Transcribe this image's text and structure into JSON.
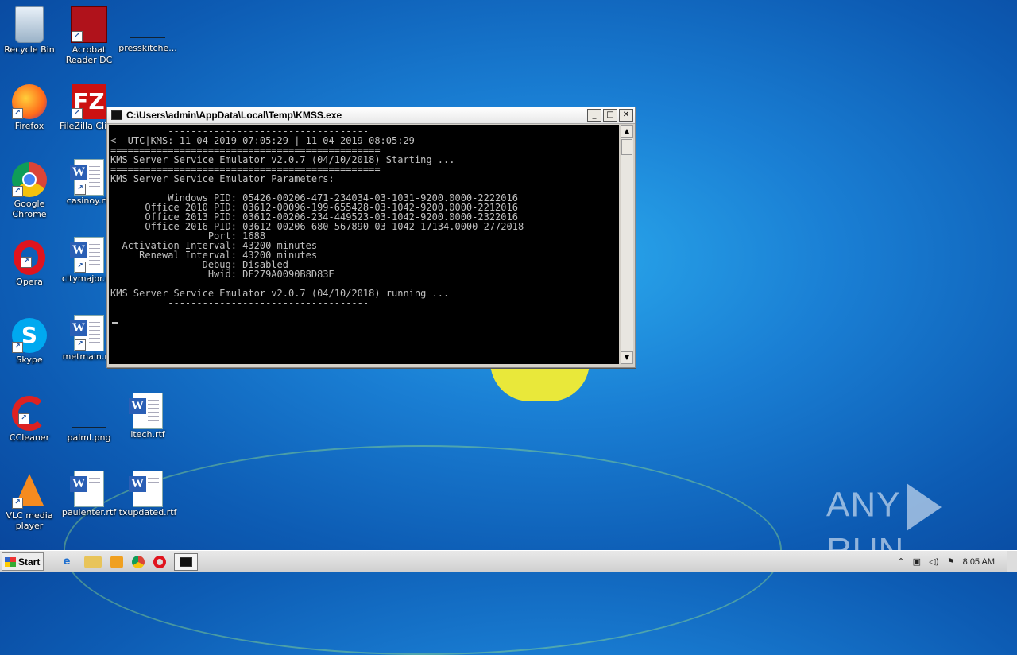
{
  "desktop": {
    "icons": [
      {
        "label": "Recycle Bin"
      },
      {
        "label": "Acrobat Reader DC"
      },
      {
        "label": "presskitche..."
      },
      {
        "label": "Firefox"
      },
      {
        "label": "FileZilla Clie..."
      },
      {
        "label": "Google Chrome"
      },
      {
        "label": "casinoy.rtf"
      },
      {
        "label": "Opera"
      },
      {
        "label": "citymajor.r..."
      },
      {
        "label": "Skype"
      },
      {
        "label": "metmain.r..."
      },
      {
        "label": "CCleaner"
      },
      {
        "label": "palml.png"
      },
      {
        "label": "ltech.rtf"
      },
      {
        "label": "VLC media player"
      },
      {
        "label": "paulenter.rtf"
      },
      {
        "label": "txupdated.rtf"
      }
    ],
    "watermark": "ANY RUN"
  },
  "window": {
    "title": "C:\\Users\\admin\\AppData\\Local\\Temp\\KMSS.exe",
    "console_lines": [
      "          -----------------------------------",
      "<- UTC|KMS: 11-04-2019 07:05:29 | 11-04-2019 08:05:29 --",
      "===============================================",
      "KMS Server Service Emulator v2.0.7 (04/10/2018) Starting ...",
      "===============================================",
      "KMS Server Service Emulator Parameters:",
      "",
      "          Windows PID: 05426-00206-471-234034-03-1031-9200.0000-2222016",
      "      Office 2010 PID: 03612-00096-199-655428-03-1042-9200.0000-2212016",
      "      Office 2013 PID: 03612-00206-234-449523-03-1042-9200.0000-2322016",
      "      Office 2016 PID: 03612-00206-680-567890-03-1042-17134.0000-2772018",
      "                 Port: 1688",
      "  Activation Interval: 43200 minutes",
      "     Renewal Interval: 43200 minutes",
      "                Debug: Disabled",
      "                 Hwid: DF279A0090B8D83E",
      "",
      "KMS Server Service Emulator v2.0.7 (04/10/2018) running ...",
      "          -----------------------------------"
    ]
  },
  "taskbar": {
    "start_label": "Start",
    "clock": "8:05 AM"
  },
  "colors": {
    "desktop_blue": "#1a7fd4",
    "console_bg": "#000000",
    "console_text": "#c0c0c0"
  }
}
